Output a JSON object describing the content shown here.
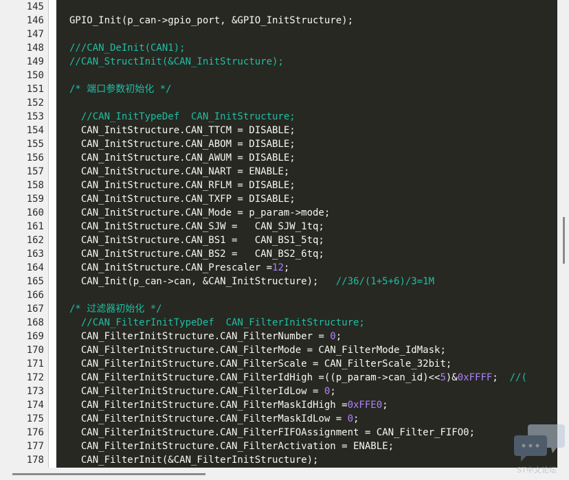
{
  "editor": {
    "lines": [
      {
        "num": "145",
        "segs": []
      },
      {
        "num": "146",
        "segs": [
          {
            "t": "GPIO_Init(p_can->gpio_port, &GPIO_InitStructure);",
            "c": "pl"
          }
        ]
      },
      {
        "num": "147",
        "segs": []
      },
      {
        "num": "148",
        "segs": [
          {
            "t": "///CAN_DeInit(CAN1);",
            "c": "cm"
          }
        ]
      },
      {
        "num": "149",
        "segs": [
          {
            "t": "//CAN_StructInit(&CAN_InitStructure);",
            "c": "cm"
          }
        ]
      },
      {
        "num": "150",
        "segs": []
      },
      {
        "num": "151",
        "segs": [
          {
            "t": "/* 端口参数初始化 */",
            "c": "cm"
          }
        ]
      },
      {
        "num": "152",
        "segs": []
      },
      {
        "num": "153",
        "segs": [
          {
            "t": "  //CAN_InitTypeDef  CAN_InitStructure;",
            "c": "cm"
          }
        ]
      },
      {
        "num": "154",
        "segs": [
          {
            "t": "  CAN_InitStructure.CAN_TTCM = DISABLE;",
            "c": "pl"
          }
        ]
      },
      {
        "num": "155",
        "segs": [
          {
            "t": "  CAN_InitStructure.CAN_ABOM = DISABLE;",
            "c": "pl"
          }
        ]
      },
      {
        "num": "156",
        "segs": [
          {
            "t": "  CAN_InitStructure.CAN_AWUM = DISABLE;",
            "c": "pl"
          }
        ]
      },
      {
        "num": "157",
        "segs": [
          {
            "t": "  CAN_InitStructure.CAN_NART = ENABLE;",
            "c": "pl"
          }
        ]
      },
      {
        "num": "158",
        "segs": [
          {
            "t": "  CAN_InitStructure.CAN_RFLM = DISABLE;",
            "c": "pl"
          }
        ]
      },
      {
        "num": "159",
        "segs": [
          {
            "t": "  CAN_InitStructure.CAN_TXFP = DISABLE;",
            "c": "pl"
          }
        ]
      },
      {
        "num": "160",
        "segs": [
          {
            "t": "  CAN_InitStructure.CAN_Mode = p_param->mode;",
            "c": "pl"
          }
        ]
      },
      {
        "num": "161",
        "segs": [
          {
            "t": "  CAN_InitStructure.CAN_SJW =   CAN_SJW_1tq;",
            "c": "pl"
          }
        ]
      },
      {
        "num": "162",
        "segs": [
          {
            "t": "  CAN_InitStructure.CAN_BS1 =   CAN_BS1_5tq;",
            "c": "pl"
          }
        ]
      },
      {
        "num": "163",
        "segs": [
          {
            "t": "  CAN_InitStructure.CAN_BS2 =   CAN_BS2_6tq;",
            "c": "pl"
          }
        ]
      },
      {
        "num": "164",
        "segs": [
          {
            "t": "  CAN_InitStructure.CAN_Prescaler =",
            "c": "pl"
          },
          {
            "t": "12",
            "c": "num"
          },
          {
            "t": ";",
            "c": "pl"
          }
        ]
      },
      {
        "num": "165",
        "segs": [
          {
            "t": "  CAN_Init(p_can->can, &CAN_InitStructure);   ",
            "c": "pl"
          },
          {
            "t": "//36/(1+5+6)/3=1M",
            "c": "cm"
          }
        ]
      },
      {
        "num": "166",
        "segs": []
      },
      {
        "num": "167",
        "segs": [
          {
            "t": "/* 过滤器初始化 */",
            "c": "cm"
          }
        ]
      },
      {
        "num": "168",
        "segs": [
          {
            "t": "  //CAN_FilterInitTypeDef  CAN_FilterInitStructure;",
            "c": "cm"
          }
        ]
      },
      {
        "num": "169",
        "segs": [
          {
            "t": "  CAN_FilterInitStructure.CAN_FilterNumber = ",
            "c": "pl"
          },
          {
            "t": "0",
            "c": "num"
          },
          {
            "t": ";",
            "c": "pl"
          }
        ]
      },
      {
        "num": "170",
        "segs": [
          {
            "t": "  CAN_FilterInitStructure.CAN_FilterMode = CAN_FilterMode_IdMask;",
            "c": "pl"
          }
        ]
      },
      {
        "num": "171",
        "segs": [
          {
            "t": "  CAN_FilterInitStructure.CAN_FilterScale = CAN_FilterScale_32bit;",
            "c": "pl"
          }
        ]
      },
      {
        "num": "172",
        "segs": [
          {
            "t": "  CAN_FilterInitStructure.CAN_FilterIdHigh =((p_param->can_id)<<",
            "c": "pl"
          },
          {
            "t": "5",
            "c": "num"
          },
          {
            "t": ")&",
            "c": "pl"
          },
          {
            "t": "0xFFFF",
            "c": "num"
          },
          {
            "t": ";  ",
            "c": "pl"
          },
          {
            "t": "//(",
            "c": "cm"
          }
        ]
      },
      {
        "num": "173",
        "segs": [
          {
            "t": "  CAN_FilterInitStructure.CAN_FilterIdLow = ",
            "c": "pl"
          },
          {
            "t": "0",
            "c": "num"
          },
          {
            "t": ";",
            "c": "pl"
          }
        ]
      },
      {
        "num": "174",
        "segs": [
          {
            "t": "  CAN_FilterInitStructure.CAN_FilterMaskIdHigh =",
            "c": "pl"
          },
          {
            "t": "0xFFE0",
            "c": "num"
          },
          {
            "t": ";",
            "c": "pl"
          }
        ]
      },
      {
        "num": "175",
        "segs": [
          {
            "t": "  CAN_FilterInitStructure.CAN_FilterMaskIdLow = ",
            "c": "pl"
          },
          {
            "t": "0",
            "c": "num"
          },
          {
            "t": ";",
            "c": "pl"
          }
        ]
      },
      {
        "num": "176",
        "segs": [
          {
            "t": "  CAN_FilterInitStructure.CAN_FilterFIFOAssignment = CAN_Filter_FIFO0;",
            "c": "pl"
          }
        ]
      },
      {
        "num": "177",
        "segs": [
          {
            "t": "  CAN_FilterInitStructure.CAN_FilterActivation = ENABLE;",
            "c": "pl"
          }
        ]
      },
      {
        "num": "178",
        "segs": [
          {
            "t": "  CAN_FilterInit(&CAN_FilterInitStructure);",
            "c": "pl"
          }
        ]
      }
    ]
  },
  "watermark": {
    "text": "ST中文论坛"
  },
  "colors": {
    "editor_bg": "#272822",
    "code_text": "#f8f8f2",
    "comment": "#1fbfa3",
    "number": "#ae81ff",
    "gutter_bg": "#f0f0f0"
  }
}
